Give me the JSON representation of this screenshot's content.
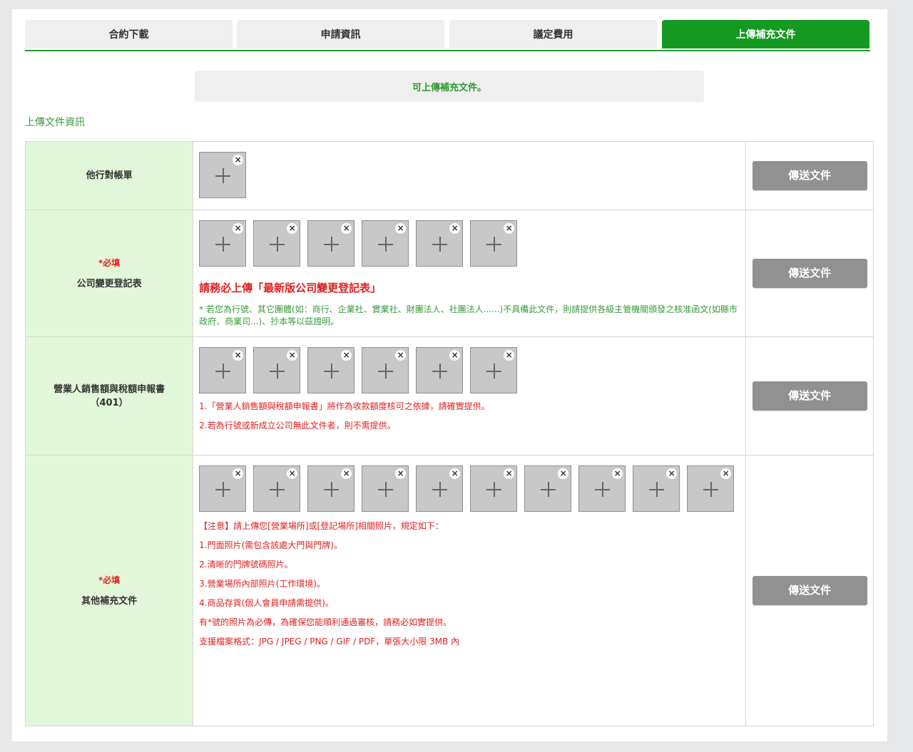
{
  "tabs": [
    {
      "label": "合約下載",
      "active": false
    },
    {
      "label": "申請資訊",
      "active": false
    },
    {
      "label": "議定費用",
      "active": false
    },
    {
      "label": "上傳補充文件",
      "active": true
    }
  ],
  "notice": "可上傳補充文件。",
  "section_title": "上傳文件資訊",
  "send_label": "傳送文件",
  "rows": [
    {
      "required": "",
      "label_lines": [
        "他行對帳單"
      ],
      "file_count": 1,
      "big_note": "",
      "green_note": "",
      "red_lines": []
    },
    {
      "required": "*必填",
      "label_lines": [
        "公司變更登記表"
      ],
      "file_count": 6,
      "big_note": "請務必上傳「最新版公司變更登記表」",
      "green_note": "* 若您為行號、其它團體(如：商行、企業社、實業社、財團法人、社團法人......)不具備此文件，則請提供各級主管機關頒發之核准函文(如縣市政府、商業司...)、抄本等以茲證明。",
      "red_lines": []
    },
    {
      "required": "",
      "label_lines": [
        "營業人銷售額與稅額申報書",
        "（401）"
      ],
      "file_count": 6,
      "big_note": "",
      "green_note": "",
      "red_lines": [
        "1.「營業人銷售額與稅額申報書」將作為收款額度核可之依據，請確實提供。",
        "2.若為行號或新成立公司無此文件者，則不需提供。"
      ]
    },
    {
      "required": "*必填",
      "label_lines": [
        "其他補充文件"
      ],
      "file_count": 10,
      "big_note": "",
      "green_note": "",
      "red_lines": [
        "【注意】請上傳您[營業場所]或[登記場所]相關照片，規定如下：",
        "1.門面照片(需包含該處大門與門牌)。",
        "2.清晰的門牌號碼照片。",
        "3.營業場所內部照片(工作環境)。",
        "4.商品存貨(個人會員申請需提供)。",
        "有*號的照片為必傳，為確保您能順利通過審核，請務必如實提供。",
        "支援檔案格式：JPG / JPEG / PNG / GIF / PDF，單張大小限 3MB 內"
      ]
    }
  ],
  "icons": {
    "add": "plus-icon",
    "remove": "close-icon"
  },
  "colors": {
    "accent": "#159a21",
    "label_bg": "#e2f7d9",
    "warning": "#e02121",
    "button": "#919191"
  }
}
